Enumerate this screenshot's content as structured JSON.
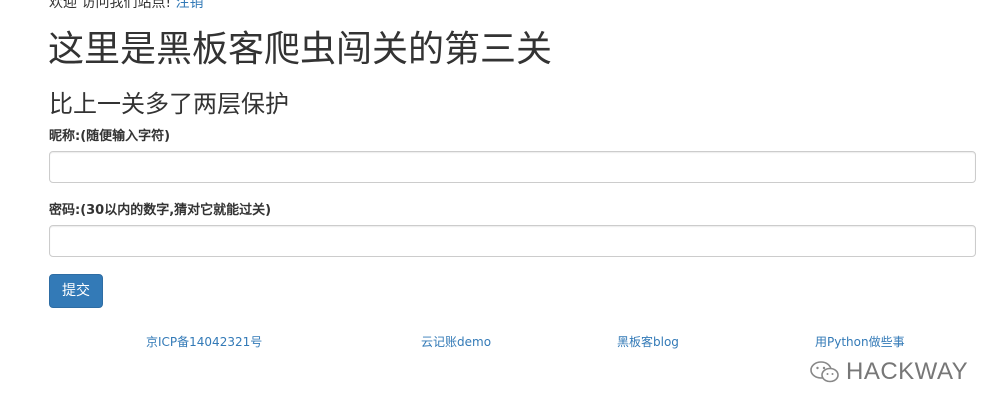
{
  "header": {
    "welcome_text": "欢迎 访问我们站点!",
    "logout_link": "注销"
  },
  "main": {
    "title": "这里是黑板客爬虫闯关的第三关",
    "subtitle": "比上一关多了两层保护"
  },
  "form": {
    "nickname_label": "昵称:(随便输入字符)",
    "nickname_value": "",
    "password_label": "密码:(30以内的数字,猜对它就能过关)",
    "password_value": "",
    "submit_label": "提交"
  },
  "footer": {
    "links": [
      "京ICP备14042321号",
      "云记账demo",
      "黑板客blog",
      "用Python做些事"
    ]
  },
  "watermark": {
    "text": "HACKWAY",
    "icon": "wechat-icon"
  },
  "colors": {
    "link": "#337ab7",
    "button_bg": "#337ab7",
    "text": "#333333",
    "border": "#cccccc"
  }
}
